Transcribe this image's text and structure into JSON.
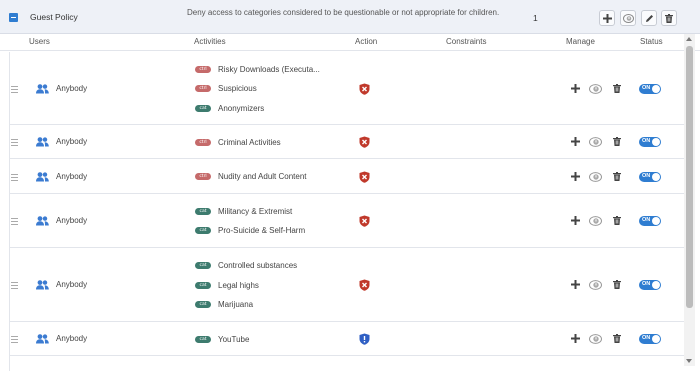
{
  "policy": {
    "name": "Guest Policy",
    "description": "Deny access to categories considered to be questionable or not appropriate for children.",
    "count": "1"
  },
  "columns": {
    "users": "Users",
    "activities": "Activities",
    "action": "Action",
    "constraints": "Constraints",
    "manage": "Manage",
    "status": "Status"
  },
  "badges": {
    "cat": "cat",
    "ctrl": "ctrl"
  },
  "rules": [
    {
      "user": "Anybody",
      "action": "block",
      "status": "ON",
      "activities": [
        {
          "type": "ctrl",
          "label": "Risky Downloads (Executa..."
        },
        {
          "type": "ctrl",
          "label": "Suspicious"
        },
        {
          "type": "cat",
          "label": "Anonymizers"
        }
      ]
    },
    {
      "user": "Anybody",
      "action": "block",
      "status": "ON",
      "activities": [
        {
          "type": "ctrl",
          "label": "Criminal Activities"
        }
      ]
    },
    {
      "user": "Anybody",
      "action": "block",
      "status": "ON",
      "activities": [
        {
          "type": "ctrl",
          "label": "Nudity and Adult Content"
        }
      ]
    },
    {
      "user": "Anybody",
      "action": "block",
      "status": "ON",
      "activities": [
        {
          "type": "cat",
          "label": "Militancy & Extremist"
        },
        {
          "type": "cat",
          "label": "Pro-Suicide & Self-Harm"
        }
      ]
    },
    {
      "user": "Anybody",
      "action": "block",
      "status": "ON",
      "activities": [
        {
          "type": "cat",
          "label": "Controlled substances"
        },
        {
          "type": "cat",
          "label": "Legal highs"
        },
        {
          "type": "cat",
          "label": "Marijuana"
        }
      ]
    },
    {
      "user": "Anybody",
      "action": "allow",
      "status": "ON",
      "activities": [
        {
          "type": "cat",
          "label": "YouTube"
        }
      ]
    }
  ],
  "colors": {
    "accent": "#2f7dd1",
    "block": "#c0392b",
    "allow": "#2f5fc4",
    "cat_badge": "#3d7b6e",
    "ctrl_badge": "#c56a6a"
  },
  "icons": {
    "add": "plus-icon",
    "schedule": "clock-icon",
    "edit": "pencil-icon",
    "delete": "trash-icon",
    "user": "users-icon",
    "block": "shield-x-icon",
    "allow": "shield-check-icon"
  }
}
